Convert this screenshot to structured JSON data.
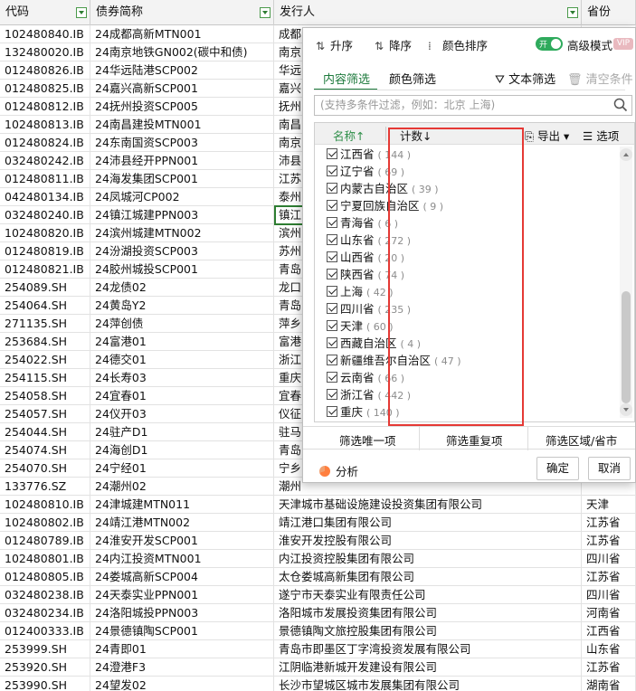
{
  "sheet": {
    "headers": [
      "代码",
      "债券简称",
      "发行人",
      "省份"
    ],
    "rows": [
      [
        "102480840.IB",
        "24成都高新MTN001",
        "成都",
        ""
      ],
      [
        "132480020.IB",
        "24南京地铁GN002(碳中和债)",
        "南京",
        ""
      ],
      [
        "012480826.IB",
        "24华远陆港SCP002",
        "华远",
        ""
      ],
      [
        "012480825.IB",
        "24嘉兴高新SCP001",
        "嘉兴",
        ""
      ],
      [
        "012480812.IB",
        "24抚州投资SCP005",
        "抚州",
        ""
      ],
      [
        "102480813.IB",
        "24南昌建投MTN001",
        "南昌",
        ""
      ],
      [
        "012480824.IB",
        "24东南国资SCP003",
        "南京",
        ""
      ],
      [
        "032480242.IB",
        "24沛县经开PPN001",
        "沛县",
        ""
      ],
      [
        "012480811.IB",
        "24海发集团SCP001",
        "江苏",
        ""
      ],
      [
        "042480134.IB",
        "24凤城河CP002",
        "泰州",
        ""
      ],
      [
        "032480240.IB",
        "24镇江城建PPN003",
        "镇江",
        ""
      ],
      [
        "102480820.IB",
        "24滨州城建MTN002",
        "滨州",
        ""
      ],
      [
        "012480819.IB",
        "24汾湖投资SCP003",
        "苏州",
        ""
      ],
      [
        "012480821.IB",
        "24胶州城投SCP001",
        "青岛",
        ""
      ],
      [
        "254089.SH",
        "24龙债02",
        "龙口",
        ""
      ],
      [
        "254064.SH",
        "24黄岛Y2",
        "青岛",
        ""
      ],
      [
        "271135.SH",
        "24萍创债",
        "萍乡",
        ""
      ],
      [
        "253684.SH",
        "24富港01",
        "富港",
        ""
      ],
      [
        "254022.SH",
        "24德交01",
        "浙江",
        ""
      ],
      [
        "254115.SH",
        "24长寿03",
        "重庆",
        ""
      ],
      [
        "254058.SH",
        "24宜春01",
        "宜春",
        ""
      ],
      [
        "254057.SH",
        "24仪开03",
        "仪征",
        ""
      ],
      [
        "254044.SH",
        "24驻产D1",
        "驻马",
        ""
      ],
      [
        "254074.SH",
        "24海创D1",
        "青岛",
        ""
      ],
      [
        "254070.SH",
        "24宁经01",
        "宁乡",
        ""
      ],
      [
        "133776.SZ",
        "24潮州02",
        "潮州",
        ""
      ],
      [
        "102480810.IB",
        "24津城建MTN011",
        "天津城市基础设施建设投资集团有限公司",
        "天津"
      ],
      [
        "102480802.IB",
        "24靖江港MTN002",
        "靖江港口集团有限公司",
        "江苏省"
      ],
      [
        "012480789.IB",
        "24淮安开发SCP001",
        "淮安开发控股有限公司",
        "江苏省"
      ],
      [
        "102480801.IB",
        "24内江投资MTN001",
        "内江投资控股集团有限公司",
        "四川省"
      ],
      [
        "012480805.IB",
        "24娄城高新SCP004",
        "太仓娄城高新集团有限公司",
        "江苏省"
      ],
      [
        "032480238.IB",
        "24天泰实业PPN001",
        "遂宁市天泰实业有限责任公司",
        "四川省"
      ],
      [
        "032480234.IB",
        "24洛阳城投PPN003",
        "洛阳城市发展投资集团有限公司",
        "河南省"
      ],
      [
        "012400333.IB",
        "24景德镇陶SCP001",
        "景德镇陶文旅控股集团有限公司",
        "江西省"
      ],
      [
        "253999.SH",
        "24青即01",
        "青岛市即墨区丁字湾投资发展有限公司",
        "山东省"
      ],
      [
        "253920.SH",
        "24澄港F3",
        "江阴临港新城开发建设有限公司",
        "江苏省"
      ],
      [
        "253990.SH",
        "24望发02",
        "长沙市望城区城市发展集团有限公司",
        "湖南省"
      ]
    ]
  },
  "popup": {
    "toolbar": {
      "sort_asc": "升序",
      "sort_desc": "降序",
      "color_sort": "颜色排序",
      "toggle_on": "开",
      "advanced_mode": "高级模式",
      "vip": "VIP"
    },
    "tabs": {
      "content_filter": "内容筛选",
      "color_filter": "颜色筛选",
      "text_filter": "文本筛选",
      "clear": "清空条件"
    },
    "search_placeholder": "(支持多条件过滤，例如：北京 上海)",
    "list_header": {
      "name": "名称↑",
      "count": "计数↓",
      "export": "导出",
      "options": "选项"
    },
    "items": [
      {
        "name": "江西省",
        "count": "( 144 )"
      },
      {
        "name": "辽宁省",
        "count": "( 69 )"
      },
      {
        "name": "内蒙古自治区",
        "count": "( 39 )"
      },
      {
        "name": "宁夏回族自治区",
        "count": "( 9 )"
      },
      {
        "name": "青海省",
        "count": "( 6 )"
      },
      {
        "name": "山东省",
        "count": "( 272 )"
      },
      {
        "name": "山西省",
        "count": "( 20 )"
      },
      {
        "name": "陕西省",
        "count": "( 74 )"
      },
      {
        "name": "上海",
        "count": "( 42 )"
      },
      {
        "name": "四川省",
        "count": "( 235 )"
      },
      {
        "name": "天津",
        "count": "( 60 )"
      },
      {
        "name": "西藏自治区",
        "count": "( 4 )"
      },
      {
        "name": "新疆维吾尔自治区",
        "count": "( 47 )"
      },
      {
        "name": "云南省",
        "count": "( 66 )"
      },
      {
        "name": "浙江省",
        "count": "( 442 )"
      },
      {
        "name": "重庆",
        "count": "( 140 )"
      }
    ],
    "bottom": {
      "unique": "筛选唯一项",
      "dup": "筛选重复项",
      "region": "筛选区域/省市"
    },
    "analyze": "分析",
    "ok": "确定",
    "cancel": "取消"
  }
}
